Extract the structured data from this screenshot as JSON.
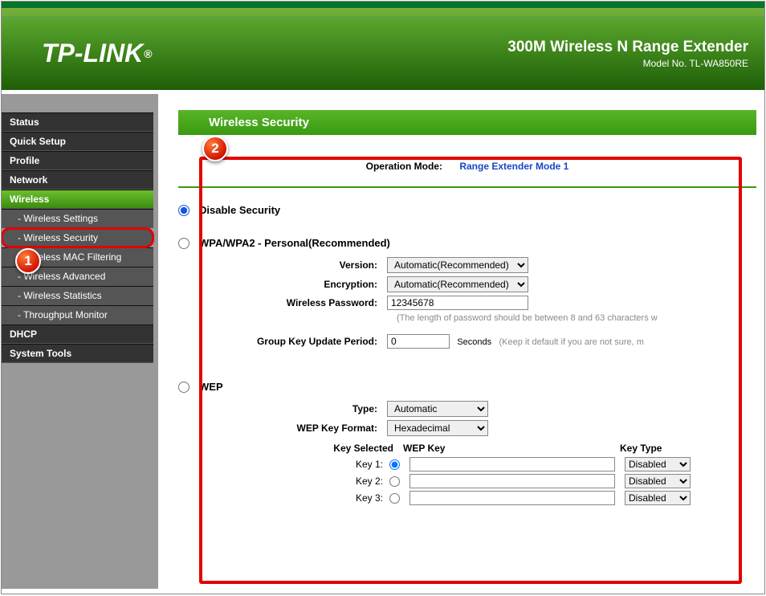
{
  "header": {
    "brand": "TP-LINK",
    "reg": "®",
    "product": "300M Wireless N Range Extender",
    "model": "Model No. TL-WA850RE"
  },
  "nav": {
    "status": "Status",
    "quick_setup": "Quick Setup",
    "profile": "Profile",
    "network": "Network",
    "wireless": "Wireless",
    "w_settings": "- Wireless Settings",
    "w_security": "- Wireless Security",
    "w_mac": "- Wireless MAC Filtering",
    "w_advanced": "- Wireless Advanced",
    "w_stats": "- Wireless Statistics",
    "w_throughput": "- Throughput Monitor",
    "dhcp": "DHCP",
    "system_tools": "System Tools"
  },
  "page": {
    "title": "Wireless Security",
    "op_mode_label": "Operation Mode:",
    "op_mode_value": "Range Extender Mode 1",
    "disable_label": "Disable Security",
    "wpa": {
      "heading": "WPA/WPA2 - Personal(Recommended)",
      "version_label": "Version:",
      "version_value": "Automatic(Recommended)",
      "encryption_label": "Encryption:",
      "encryption_value": "Automatic(Recommended)",
      "password_label": "Wireless Password:",
      "password_value": "12345678",
      "password_hint": "(The length of password should be between 8 and 63 characters w",
      "group_label": "Group Key Update Period:",
      "group_value": "0",
      "group_unit": "Seconds",
      "group_hint": "(Keep it default if you are not sure, m"
    },
    "wep": {
      "heading": "WEP",
      "type_label": "Type:",
      "type_value": "Automatic",
      "format_label": "WEP Key Format:",
      "format_value": "Hexadecimal",
      "col_sel": "Key Selected",
      "col_key": "WEP Key",
      "col_type": "Key Type",
      "k1": "Key 1:",
      "k2": "Key 2:",
      "k3": "Key 3:",
      "disabled": "Disabled"
    }
  },
  "callouts": {
    "one": "1",
    "two": "2"
  }
}
